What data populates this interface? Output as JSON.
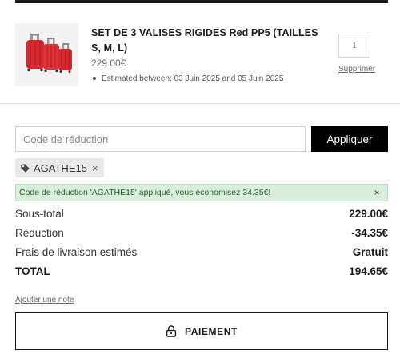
{
  "cart_item": {
    "title": "SET DE 3 VALISES RIGIDES Red PP5 (TAILLES S, M, L)",
    "price": "229.00€",
    "estimate": "Estimated between: 03 Juin 2025 and 05 Juin 2025",
    "quantity": "1",
    "remove_label": "Supprimer",
    "image_icon": "suitcase-set-image"
  },
  "discount": {
    "placeholder": "Code de réduction",
    "apply_label": "Appliquer",
    "applied_code": "AGATHE15",
    "remove_code_symbol": "×",
    "success_message": "Code de réduction 'AGATHE15' appliqué, vous économisez 34.35€!",
    "close_symbol": "×"
  },
  "summary": {
    "subtotal_label": "Sous-total",
    "subtotal_value": "229.00€",
    "discount_label": "Réduction",
    "discount_value": "-34.35€",
    "shipping_label": "Frais de livraison estimés",
    "shipping_value": "Gratuit",
    "total_label": "TOTAL",
    "total_value": "194.65€"
  },
  "add_note_label": "Ajouter une note",
  "checkout": {
    "label": "PAIEMENT",
    "icon": "lock-icon"
  },
  "colors": {
    "accent": "#000000",
    "success_bg": "#d8efdb",
    "success_text": "#2a5d34",
    "product_red": "#d9272e"
  }
}
